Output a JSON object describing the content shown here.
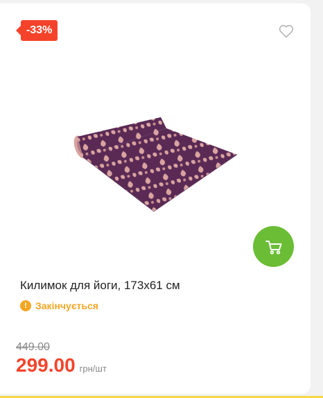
{
  "product": {
    "discount_badge": "-33%",
    "title": "Килимок для йоги, 173x61 см",
    "stock_status": "Закінчується",
    "old_price": "449.00",
    "price": "299.00",
    "price_unit": "грн/шт"
  },
  "icons": {
    "favorite": "heart-icon",
    "cart": "cart-icon",
    "warning": "warning-icon"
  },
  "colors": {
    "discount": "#f5432b",
    "cart_button": "#6bbd35",
    "warning": "#f5a623",
    "mat_purple": "#5a2a55",
    "mat_pattern": "#d9a3a0"
  }
}
